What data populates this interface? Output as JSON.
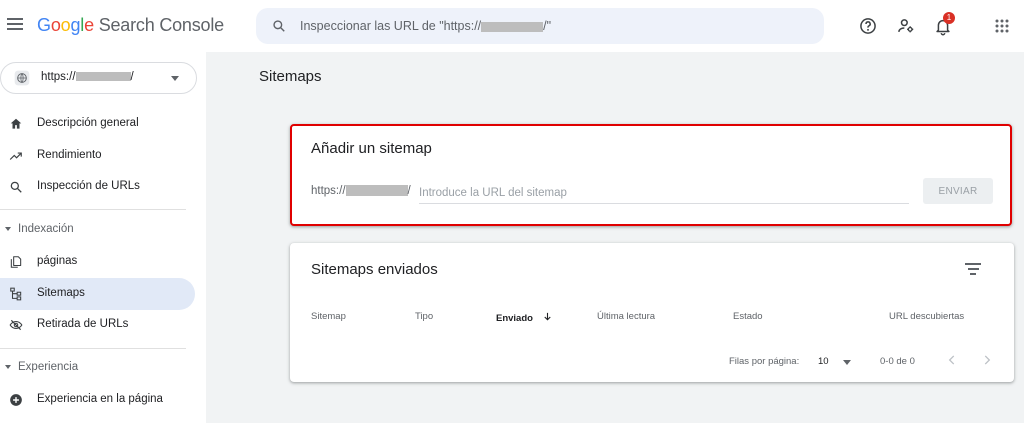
{
  "header": {
    "logo_google": "Google",
    "logo_product": "Search Console",
    "search_prefix": "Inspeccionar las URL de \"https://",
    "search_suffix": "/\"",
    "notification_count": "1"
  },
  "sidebar": {
    "property_prefix": "https://",
    "property_suffix": "/",
    "items": [
      {
        "label": "Descripción general",
        "icon": "home-icon"
      },
      {
        "label": "Rendimiento",
        "icon": "trending-up-icon"
      },
      {
        "label": "Inspección de URLs",
        "icon": "search-icon"
      }
    ],
    "section_indexing": "Indexación",
    "indexing_items": [
      {
        "label": "páginas",
        "icon": "file-copy-icon"
      },
      {
        "label": "Sitemaps",
        "icon": "sitemap-icon",
        "active": true
      },
      {
        "label": "Retirada de URLs",
        "icon": "visibility-off-icon"
      }
    ],
    "section_experience": "Experiencia",
    "experience_items": [
      {
        "label": "Experiencia en la página",
        "icon": "add-circle-icon"
      }
    ]
  },
  "main": {
    "page_title": "Sitemaps",
    "add_card": {
      "title": "Añadir un sitemap",
      "prefix_start": "https://",
      "prefix_end": "/",
      "placeholder": "Introduce la URL del sitemap",
      "submit_label": "ENVIAR"
    },
    "submitted_card": {
      "title": "Sitemaps enviados",
      "columns": [
        "Sitemap",
        "Tipo",
        "Enviado",
        "Última lectura",
        "Estado",
        "URL descubiertas"
      ],
      "sorted_column": "Enviado",
      "rows_per_page_label": "Filas por página:",
      "rows_per_page_value": "10",
      "range_label": "0-0 de 0"
    }
  },
  "colors": {
    "highlight_border": "#e00000",
    "active_nav_bg": "#e1e9f7",
    "search_bg": "#eef2fa",
    "badge": "#d93025"
  }
}
